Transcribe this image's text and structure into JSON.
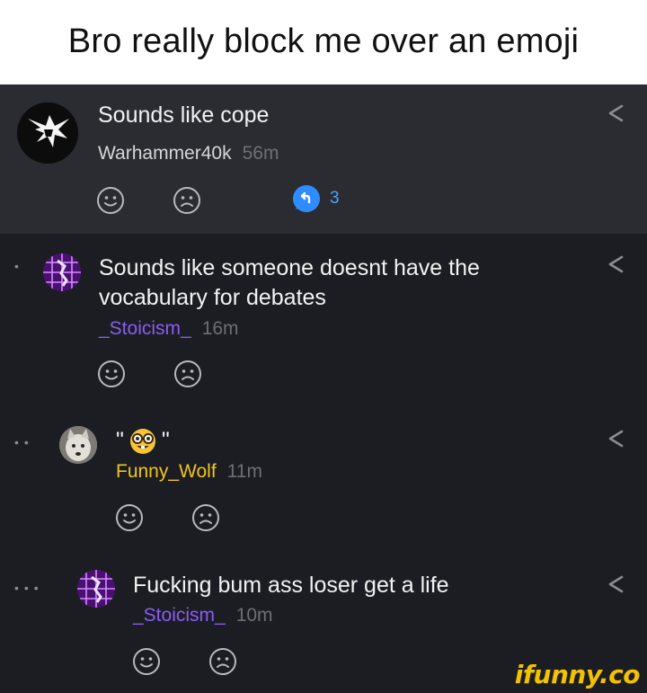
{
  "header": {
    "title": "Bro really block me over an emoji"
  },
  "comments": [
    {
      "text": "Sounds like cope",
      "username": "Warhammer40k",
      "time": "56m",
      "replies": "3",
      "avatar_icon": "warhammer-logo-icon"
    },
    {
      "text_line1": "Sounds like someone doesnt have the",
      "text_line2": "vocabulary for debates",
      "username": "_Stoicism_",
      "time": "16m",
      "avatar_icon": "purple-grid-avatar"
    },
    {
      "text_prefix": "\"",
      "text_suffix": "\"",
      "emoji_icon": "nerd-face-emoji",
      "username": "Funny_Wolf",
      "time": "11m",
      "avatar_icon": "wolf-avatar"
    },
    {
      "text": "Fucking bum ass loser get a life",
      "username": "_Stoicism_",
      "time": "10m",
      "avatar_icon": "purple-grid-avatar"
    }
  ],
  "watermark": "ifunny.co",
  "colors": {
    "thread_bg": "#1c1d22",
    "highlight_bg": "#2b2c32",
    "purple_user": "#8a5cf5",
    "gold_user": "#f0c420",
    "reply_blue": "#4aa3ff",
    "watermark": "#f2c100"
  }
}
